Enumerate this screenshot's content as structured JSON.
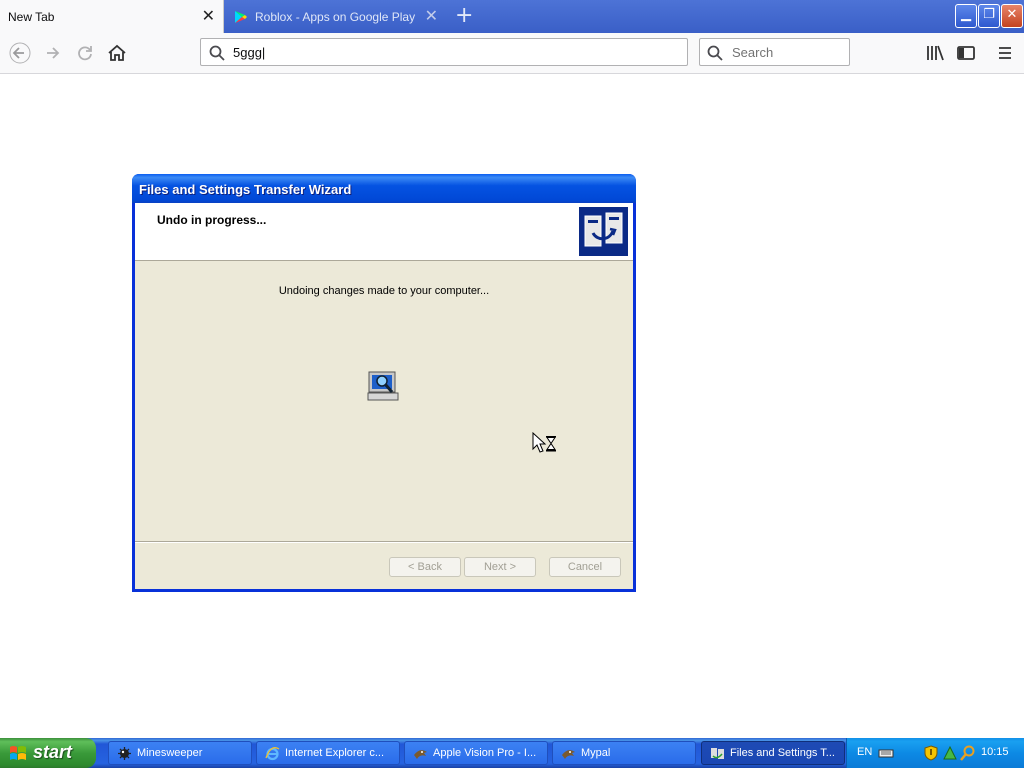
{
  "browser": {
    "tabs": [
      {
        "title": "New Tab",
        "active": true
      },
      {
        "title": "Roblox - Apps on Google Play",
        "active": false
      }
    ],
    "url_value": "5ggg|",
    "search_placeholder": "Search",
    "icons": [
      "back-icon",
      "forward-icon",
      "reload-icon",
      "home-icon",
      "library-icon",
      "sidebar-icon",
      "menu-icon"
    ]
  },
  "wizard": {
    "title": "Files and Settings Transfer Wizard",
    "header": "Undo in progress...",
    "message": "Undoing changes made to your computer...",
    "buttons": {
      "back": "< Back",
      "next": "Next >",
      "cancel": "Cancel"
    }
  },
  "taskbar": {
    "start_label": "start",
    "tasks": [
      {
        "label": "Minesweeper"
      },
      {
        "label": "Internet Explorer c..."
      },
      {
        "label": "Apple Vision Pro - I..."
      },
      {
        "label": "Mypal"
      },
      {
        "label": "Files and Settings T..."
      }
    ],
    "language": "EN",
    "clock": "10:15"
  },
  "colors": {
    "xp_blue": "#0831d9",
    "dialog_face": "#ece9d8",
    "start_green": "#3a9a3a",
    "tray_blue": "#0d8ae5"
  }
}
